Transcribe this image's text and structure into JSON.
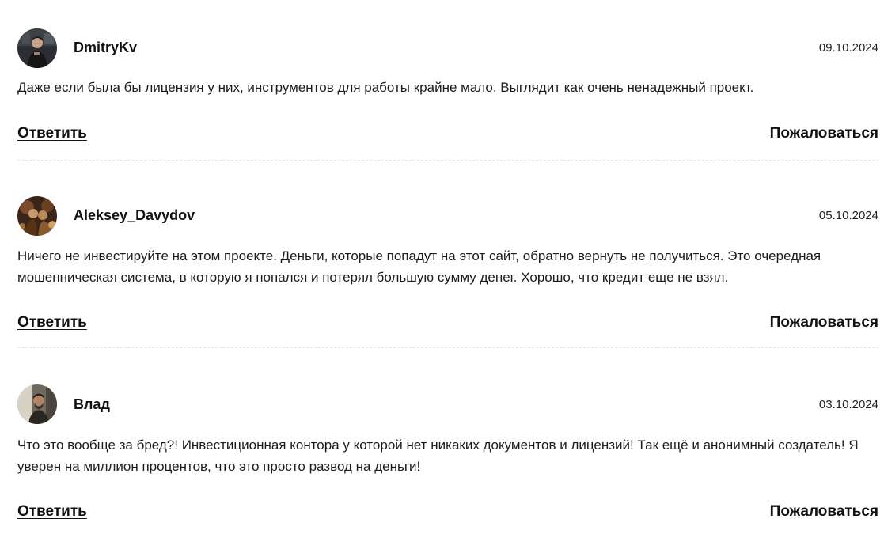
{
  "comments": [
    {
      "author": "DmitryKv",
      "date": "09.10.2024",
      "text": "Даже если была бы лицензия у них, инструментов для работы крайне мало. Выглядит как очень ненадежный проект.",
      "reply_label": "Ответить",
      "complain_label": "Пожаловаться"
    },
    {
      "author": "Aleksey_Davydov",
      "date": "05.10.2024",
      "text": "Ничего не инвестируйте на этом проекте. Деньги, которые попадут на этот сайт, обратно вернуть не получиться. Это очередная мошенническая система, в которую я попался и потерял большую сумму денег. Хорошо, что кредит еще не взял.",
      "reply_label": "Ответить",
      "complain_label": "Пожаловаться"
    },
    {
      "author": "Влад",
      "date": "03.10.2024",
      "text": "Что это вообще за бред?! Инвестиционная контора у которой нет никаких документов и лицензий! Так ещё и анонимный создатель! Я уверен на миллион процентов, что это просто развод на деньги!",
      "reply_label": "Ответить",
      "complain_label": "Пожаловаться"
    }
  ]
}
